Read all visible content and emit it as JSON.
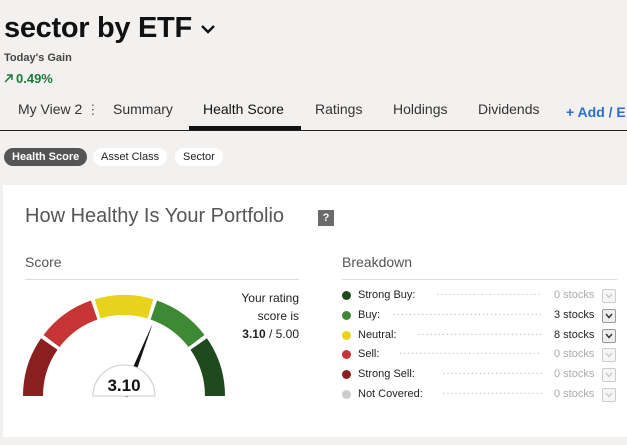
{
  "header": {
    "title": "sector by ETF",
    "gain_label": "Today's Gain",
    "gain_value": "0.49%"
  },
  "tabs": [
    {
      "label": "My View 2",
      "more": "⋮"
    },
    {
      "label": "Summary"
    },
    {
      "label": "Health Score",
      "active": true
    },
    {
      "label": "Ratings"
    },
    {
      "label": "Holdings"
    },
    {
      "label": "Dividends"
    },
    {
      "label": "+ Add / E"
    }
  ],
  "pills": [
    {
      "label": "Health Score",
      "active": true
    },
    {
      "label": "Asset Class"
    },
    {
      "label": "Sector"
    }
  ],
  "card": {
    "title": "How Healthy Is Your Portfolio",
    "help": "?",
    "score_title": "Score",
    "breakdown_title": "Breakdown"
  },
  "score": {
    "value": "3.10",
    "max": "5.00",
    "rating_line1": "Your rating",
    "rating_line2": "score is",
    "rating_sep": " / ",
    "fraction": 0.62
  },
  "gauge_colors": [
    "#8a1f1f",
    "#c63434",
    "#e8d21c",
    "#3e8a34",
    "#1e4a1e"
  ],
  "breakdown": [
    {
      "label": "Strong Buy:",
      "count": "0 stocks",
      "color": "#1e4a1e",
      "active": false
    },
    {
      "label": "Buy:",
      "count": "3 stocks",
      "color": "#3e8a34",
      "active": true
    },
    {
      "label": "Neutral:",
      "count": "8 stocks",
      "color": "#e8d21c",
      "active": true
    },
    {
      "label": "Sell:",
      "count": "0 stocks",
      "color": "#c63434",
      "active": false
    },
    {
      "label": "Strong Sell:",
      "count": "0 stocks",
      "color": "#8a1f1f",
      "active": false
    },
    {
      "label": "Not Covered:",
      "count": "0 stocks",
      "color": "#cccccc",
      "active": false
    }
  ]
}
